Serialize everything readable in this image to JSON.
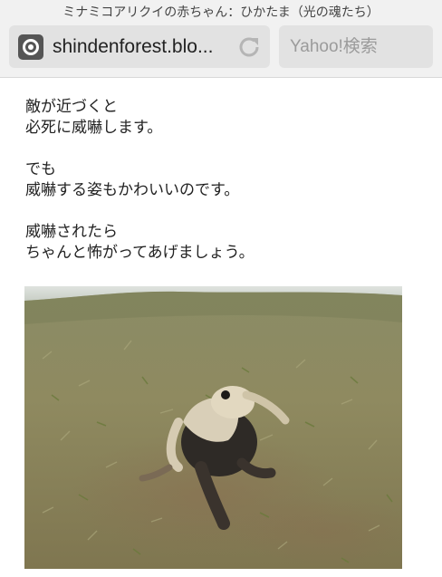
{
  "browser": {
    "title": "ミナミコアリクイの赤ちゃん：ひかたま（光の魂たち）",
    "url": "shindenforest.blo...",
    "search_placeholder": "Yahoo!検索"
  },
  "article": {
    "paragraphs": [
      [
        "敵が近づくと",
        "必死に威嚇します。"
      ],
      [
        "でも",
        "威嚇する姿もかわいいのです。"
      ],
      [
        "威嚇されたら",
        "ちゃんと怖がってあげましょう。"
      ]
    ]
  },
  "colors": {
    "chrome_bg": "#f1f1f1",
    "field_bg": "#e2e2e2",
    "text": "#222222",
    "placeholder": "#9b9b9b"
  },
  "icons": {
    "site": "site-favicon-icon",
    "reload": "reload-icon"
  }
}
